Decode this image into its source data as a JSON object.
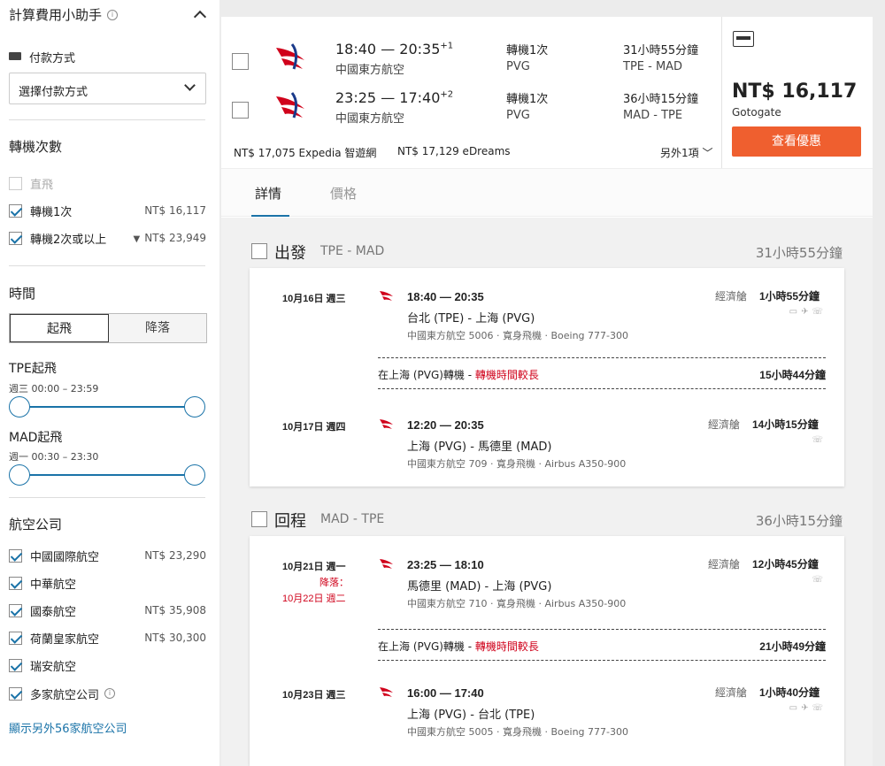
{
  "sidebar": {
    "title": "計算費用小助手",
    "payment": {
      "label": "付款方式",
      "select_value": "選擇付款方式"
    },
    "stops": {
      "title": "轉機次數",
      "options": [
        {
          "label": "直飛",
          "price": "",
          "checked": false,
          "disabled": true
        },
        {
          "label": "轉機1次",
          "price": "NT$ 16,117",
          "checked": true
        },
        {
          "label": "轉機2次或以上",
          "price": "NT$ 23,949",
          "checked": true
        }
      ]
    },
    "time": {
      "title": "時間",
      "tabs": [
        "起飛",
        "降落"
      ],
      "tpe_label": "TPE起飛",
      "tpe_range": "週三 00:00 – 23:59",
      "mad_label": "MAD起飛",
      "mad_range": "週一 00:30 – 23:30"
    },
    "airlines": {
      "title": "航空公司",
      "options": [
        {
          "label": "中國國際航空",
          "price": "NT$ 23,290"
        },
        {
          "label": "中華航空",
          "price": ""
        },
        {
          "label": "國泰航空",
          "price": "NT$ 35,908"
        },
        {
          "label": "荷蘭皇家航空",
          "price": "NT$ 30,300"
        },
        {
          "label": "瑞安航空",
          "price": ""
        },
        {
          "label": "多家航空公司",
          "price": ""
        }
      ],
      "more_link": "顯示另外56家航空公司"
    }
  },
  "result": {
    "flights": [
      {
        "time": "18:40 — 20:35",
        "plus": "+1",
        "airline": "中國東方航空",
        "stops": "轉機1次",
        "via": "PVG",
        "duration": "31小時55分鐘",
        "route": "TPE - MAD"
      },
      {
        "time": "23:25 — 17:40",
        "plus": "+2",
        "airline": "中國東方航空",
        "stops": "轉機1次",
        "via": "PVG",
        "duration": "36小時15分鐘",
        "route": "MAD - TPE"
      }
    ],
    "alt_prices": [
      "NT$ 17,075 Expedia 智遊網",
      "NT$ 17,129 eDreams"
    ],
    "more": "另外1項",
    "price": "NT$ 16,117",
    "vendor": "Gotogate",
    "deal_button": "查看優惠",
    "tabs": [
      "詳情",
      "價格"
    ]
  },
  "outbound": {
    "title": "出發",
    "route": "TPE - MAD",
    "duration": "31小時55分鐘",
    "legs": [
      {
        "date": "10月16日 週三",
        "time": "18:40 — 20:35",
        "route": "台北 (TPE) - 上海 (PVG)",
        "info": "中國東方航空 5006 · 寬身飛機 · Boeing 777-300",
        "cabin": "經濟艙",
        "duration": "1小時55分鐘"
      },
      {
        "date": "10月17日 週四",
        "time": "12:20 — 20:35",
        "route": "上海 (PVG) - 馬德里 (MAD)",
        "info": "中國東方航空 709 · 寬身飛機 · Airbus A350-900",
        "cabin": "經濟艙",
        "duration": "14小時15分鐘"
      }
    ],
    "layover": {
      "place": "在上海 (PVG)轉機 - ",
      "warning": "轉機時間較長",
      "duration": "15小時44分鐘"
    }
  },
  "inbound": {
    "title": "回程",
    "route": "MAD - TPE",
    "duration": "36小時15分鐘",
    "legs": [
      {
        "date": "10月21日 週一",
        "landing_label": "降落：",
        "landing_date": "10月22日 週二",
        "time": "23:25 — 18:10",
        "route": "馬德里 (MAD) - 上海 (PVG)",
        "info": "中國東方航空 710 · 寬身飛機 · Airbus A350-900",
        "cabin": "經濟艙",
        "duration": "12小時45分鐘"
      },
      {
        "date": "10月23日 週三",
        "time": "16:00 — 17:40",
        "route": "上海 (PVG) - 台北 (TPE)",
        "info": "中國東方航空 5005 · 寬身飛機 · Boeing 777-300",
        "cabin": "經濟艙",
        "duration": "1小時40分鐘"
      }
    ],
    "layover": {
      "place": "在上海 (PVG)轉機 - ",
      "warning": "轉機時間較長",
      "duration": "21小時49分鐘"
    }
  },
  "colors": {
    "accent": "#1a73a8",
    "deal": "#ef5f2f",
    "warning": "#d0021b"
  }
}
